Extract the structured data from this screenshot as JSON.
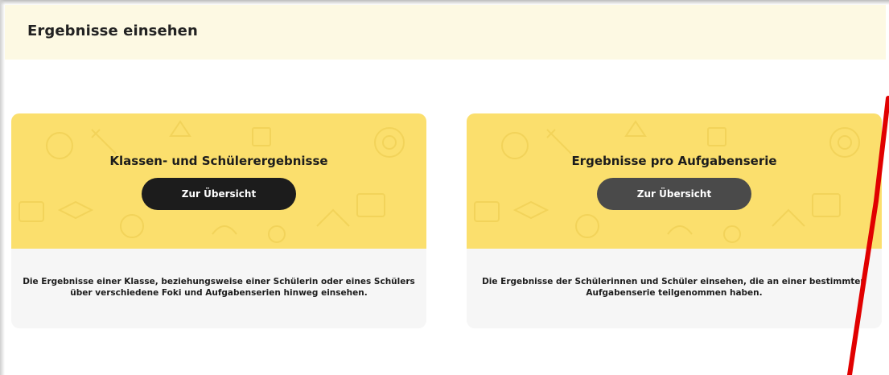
{
  "header": {
    "title": "Ergebnisse einsehen"
  },
  "cards": [
    {
      "title": "Klassen- und Schülerergebnisse",
      "button_label": "Zur Übersicht",
      "description": "Die Ergebnisse einer Klasse, beziehungsweise einer Schülerin oder eines Schülers über verschiedene Foki und Aufgabenserien hinweg einsehen."
    },
    {
      "title": "Ergebnisse pro Aufgabenserie",
      "button_label": "Zur Übersicht",
      "description": "Die Ergebnisse der Schülerinnen und Schüler einsehen, die an einer bestimmten Aufgabenserie teilgenommen haben."
    }
  ],
  "colors": {
    "header_bg": "#fdf9e3",
    "card_accent": "#fbdf6d",
    "button_dark": "#1c1c1c",
    "button_gray": "#4a4a4a",
    "annotation": "#e10000"
  }
}
